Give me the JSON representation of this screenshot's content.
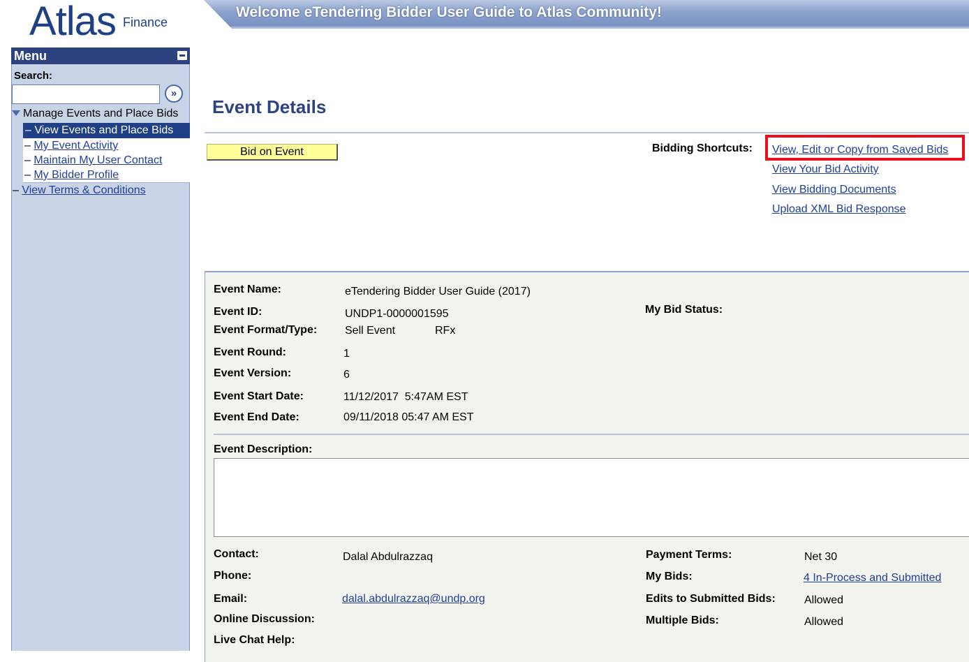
{
  "header": {
    "logo_main": "Atlas",
    "logo_sub": "Finance",
    "banner_text": "Welcome eTendering Bidder User Guide to Atlas Community!"
  },
  "sidebar": {
    "menu_title": "Menu",
    "search_label": "Search:",
    "search_value": "",
    "group_label": "Manage Events and Place Bids",
    "items": [
      {
        "label": "View Events and Place Bids",
        "selected": true
      },
      {
        "label": "My Event Activity"
      },
      {
        "label": "Maintain My User Contact"
      },
      {
        "label": "My Bidder Profile"
      }
    ],
    "terms_label": "View Terms & Conditions"
  },
  "main": {
    "title": "Event Details",
    "bid_button": "Bid on Event",
    "shortcuts_label": "Bidding Shortcuts:",
    "shortcuts": [
      "View, Edit or Copy from Saved Bids",
      "View Your Bid Activity",
      "View Bidding Documents",
      "Upload XML Bid Response"
    ]
  },
  "event": {
    "name_label": "Event Name:",
    "name": "eTendering Bidder User Guide (2017)",
    "id_label": "Event ID:",
    "id": "UNDP1-0000001595",
    "format_label": "Event Format/Type:",
    "format": "Sell Event",
    "type": "RFx",
    "round_label": "Event Round:",
    "round": "1",
    "version_label": "Event Version:",
    "version": "6",
    "start_label": "Event Start Date:",
    "start": "11/12/2017  5:47AM EST",
    "end_label": "Event End Date:",
    "end": "09/11/2018 05:47 AM EST",
    "bid_status_label": "My Bid Status:",
    "description_label": "Event Description:",
    "description": "",
    "contact_label": "Contact:",
    "contact": "Dalal Abdulrazzaq",
    "phone_label": "Phone:",
    "email_label": "Email:",
    "email": "dalal.abdulrazzaq@undp.org",
    "discussion_label": "Online Discussion:",
    "chat_label": "Live Chat Help:",
    "payment_label": "Payment Terms:",
    "payment": "Net 30",
    "mybids_label": "My Bids:",
    "mybids": "4 In-Process and Submitted",
    "edits_label": "Edits to Submitted Bids:",
    "edits": "Allowed",
    "multiple_label": "Multiple Bids:",
    "multiple": "Allowed"
  },
  "colors": {
    "brand_blue": "#2d4380",
    "highlight_red": "#e8101e",
    "button_yellow": "#ffff99",
    "link_blue": "#1f3f9a"
  }
}
